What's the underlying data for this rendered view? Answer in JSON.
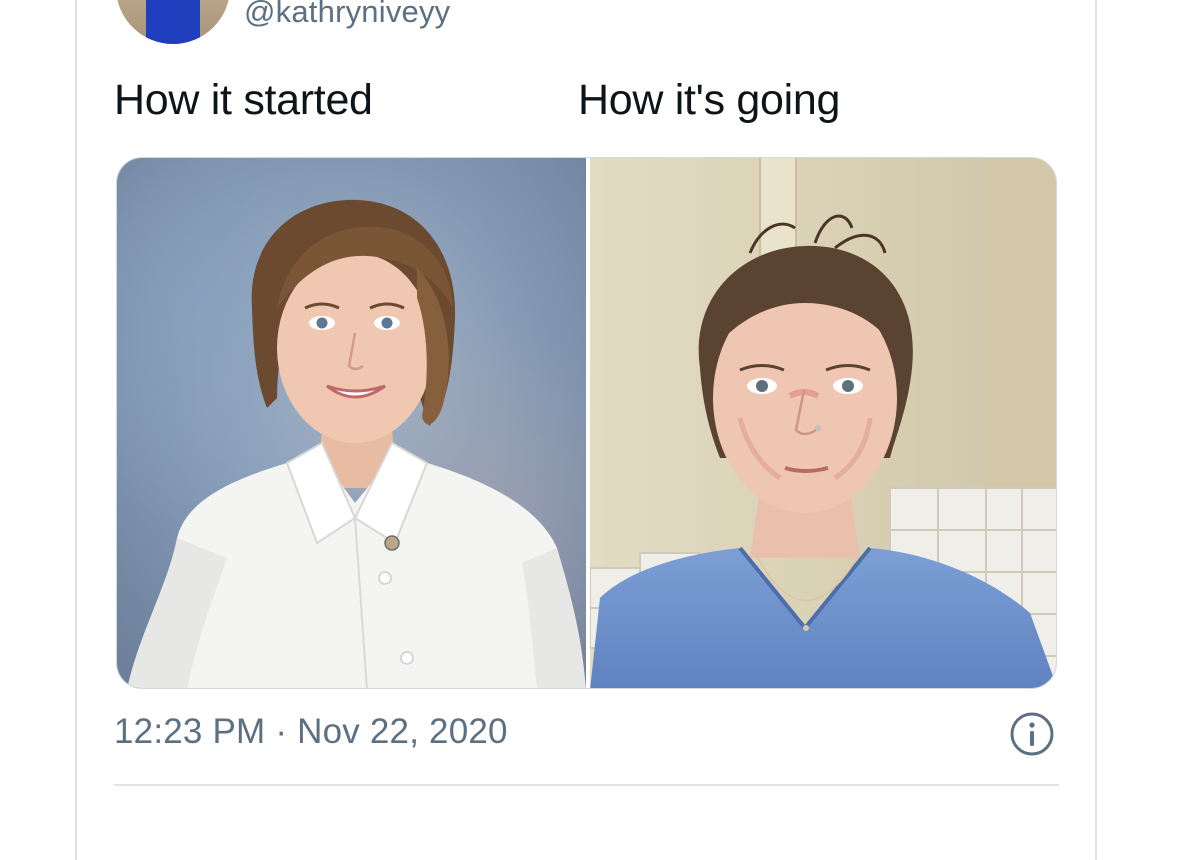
{
  "tweet": {
    "handle": "@kathryniveyy",
    "caption_left": "How it started",
    "caption_right": "How it's going",
    "timestamp": "12:23 PM · Nov 22, 2020",
    "info_icon": "info-circle-icon"
  },
  "colors": {
    "text_primary": "#0f1419",
    "text_secondary": "#5b7083",
    "border": "#dfe3e7"
  }
}
